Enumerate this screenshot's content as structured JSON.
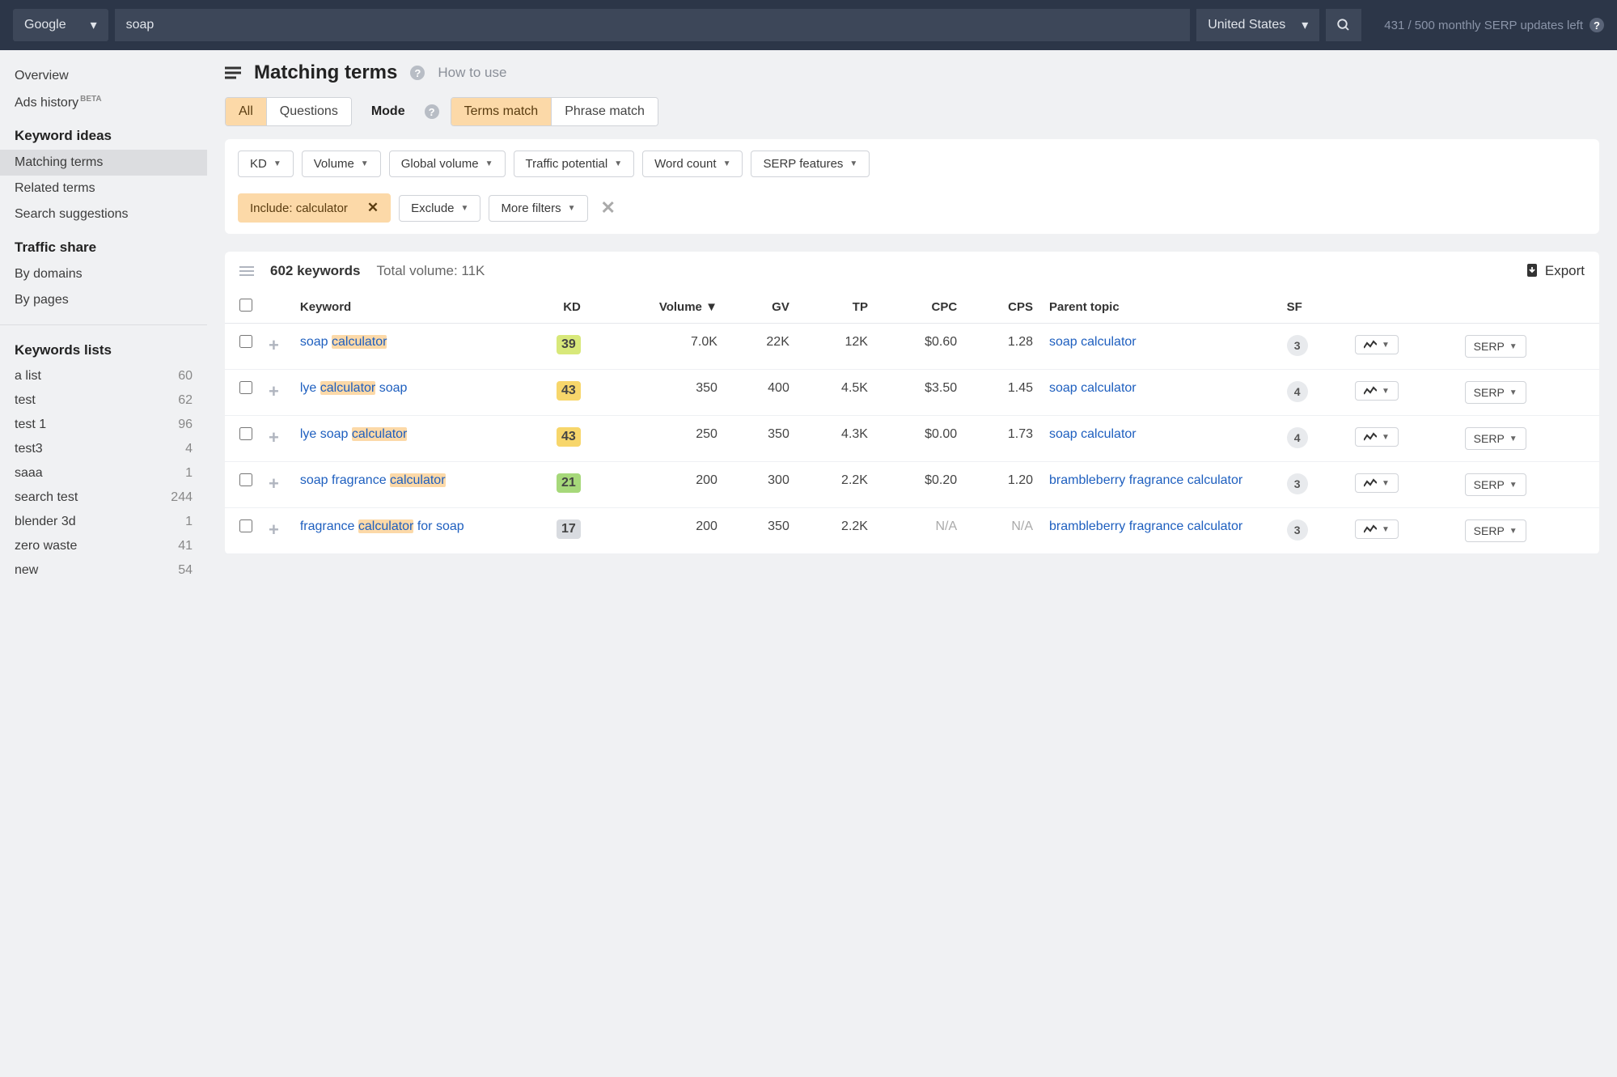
{
  "topbar": {
    "engine": "Google",
    "query": "soap",
    "country": "United States",
    "serp_updates": "431 / 500 monthly SERP updates left"
  },
  "sidebar": {
    "overview": "Overview",
    "ads_history": "Ads history",
    "beta": "BETA",
    "section_keyword_ideas": "Keyword ideas",
    "matching_terms": "Matching terms",
    "related_terms": "Related terms",
    "search_suggestions": "Search suggestions",
    "section_traffic_share": "Traffic share",
    "by_domains": "By domains",
    "by_pages": "By pages",
    "section_kw_lists": "Keywords lists",
    "lists": [
      {
        "name": "a list",
        "count": "60"
      },
      {
        "name": "test",
        "count": "62"
      },
      {
        "name": "test 1",
        "count": "96"
      },
      {
        "name": "test3",
        "count": "4"
      },
      {
        "name": "saaa",
        "count": "1"
      },
      {
        "name": "search test",
        "count": "244"
      },
      {
        "name": "blender 3d",
        "count": "1"
      },
      {
        "name": "zero waste",
        "count": "41"
      },
      {
        "name": "new",
        "count": "54"
      }
    ]
  },
  "header": {
    "title": "Matching terms",
    "how_to_use": "How to use"
  },
  "segments": {
    "all": "All",
    "questions": "Questions",
    "mode_label": "Mode",
    "terms_match": "Terms match",
    "phrase_match": "Phrase match"
  },
  "filters": {
    "kd": "KD",
    "volume": "Volume",
    "global_volume": "Global volume",
    "traffic_potential": "Traffic potential",
    "word_count": "Word count",
    "serp_features": "SERP features",
    "include_chip": "Include: calculator",
    "exclude": "Exclude",
    "more": "More filters"
  },
  "table_meta": {
    "keywords_count": "602 keywords",
    "total_volume": "Total volume: 11K",
    "export": "Export"
  },
  "columns": {
    "keyword": "Keyword",
    "kd": "KD",
    "volume": "Volume",
    "gv": "GV",
    "tp": "TP",
    "cpc": "CPC",
    "cps": "CPS",
    "parent": "Parent topic",
    "sf": "SF",
    "serp": "SERP"
  },
  "rows": [
    {
      "kw_pre": "soap ",
      "kw_hl": "calculator",
      "kw_post": "",
      "kd": "39",
      "kd_color": "#d8e87a",
      "vol": "7.0K",
      "gv": "22K",
      "tp": "12K",
      "cpc": "$0.60",
      "cps": "1.28",
      "parent": "soap calculator",
      "sf": "3"
    },
    {
      "kw_pre": "lye ",
      "kw_hl": "calculator",
      "kw_post": " soap",
      "kd": "43",
      "kd_color": "#f7d66b",
      "vol": "350",
      "gv": "400",
      "tp": "4.5K",
      "cpc": "$3.50",
      "cps": "1.45",
      "parent": "soap calculator",
      "sf": "4"
    },
    {
      "kw_pre": "lye soap ",
      "kw_hl": "calculator",
      "kw_post": "",
      "kd": "43",
      "kd_color": "#f7d66b",
      "vol": "250",
      "gv": "350",
      "tp": "4.3K",
      "cpc": "$0.00",
      "cps": "1.73",
      "parent": "soap calculator",
      "sf": "4"
    },
    {
      "kw_pre": "soap fragrance ",
      "kw_hl": "calculator",
      "kw_post": "",
      "kd": "21",
      "kd_color": "#a6d87a",
      "vol": "200",
      "gv": "300",
      "tp": "2.2K",
      "cpc": "$0.20",
      "cps": "1.20",
      "parent": "brambleberry fragrance calculator",
      "sf": "3"
    },
    {
      "kw_pre": "fragrance ",
      "kw_hl": "calculator",
      "kw_post": " for soap",
      "kd": "17",
      "kd_color": "#d8dbe0",
      "vol": "200",
      "gv": "350",
      "tp": "2.2K",
      "cpc": "N/A",
      "cps": "N/A",
      "parent": "brambleberry fragrance calculator",
      "sf": "3"
    }
  ]
}
